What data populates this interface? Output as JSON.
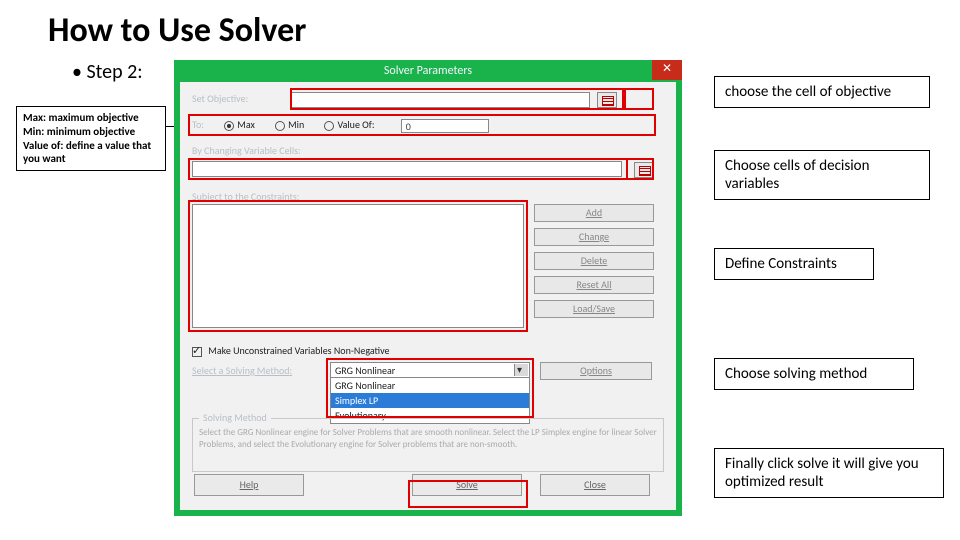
{
  "title": "How to Use Solver",
  "step_label": "• Step 2:",
  "left_note": {
    "l1": "Max: maximum objective",
    "l2": "Min: minimum objective",
    "l3": "Value of: define a value that you want"
  },
  "annotations": {
    "a1": "choose the cell of objective",
    "a2": "Choose cells of decision variables",
    "a3": "Define Constraints",
    "a4": "Choose solving method",
    "a5": "Finally click solve it will give you optimized result"
  },
  "dialog": {
    "title": "Solver Parameters",
    "close_icon": "✕",
    "set_objective_label": "Set Objective:",
    "to_label": "To:",
    "radios": {
      "max": "Max",
      "min": "Min",
      "valof": "Value Of:"
    },
    "valof_value": "0",
    "by_changing_label": "By Changing Variable Cells:",
    "subject_label": "Subject to the Constraints:",
    "buttons": {
      "add": "Add",
      "change": "Change",
      "delete": "Delete",
      "reset": "Reset All",
      "loadsave": "Load/Save"
    },
    "nonneg_label": "Make Unconstrained Variables Non-Negative",
    "method_label": "Select a Solving Method:",
    "method_selected": "GRG Nonlinear",
    "method_options": [
      "GRG Nonlinear",
      "Simplex LP",
      "Evolutionary"
    ],
    "options_btn": "Options",
    "method_group_title": "Solving Method",
    "method_group_text": "Select the GRG Nonlinear engine for Solver Problems that are smooth nonlinear. Select the LP Simplex engine for linear Solver Problems, and select the Evolutionary engine for Solver problems that are non-smooth.",
    "help": "Help",
    "solve": "Solve",
    "close": "Close"
  }
}
